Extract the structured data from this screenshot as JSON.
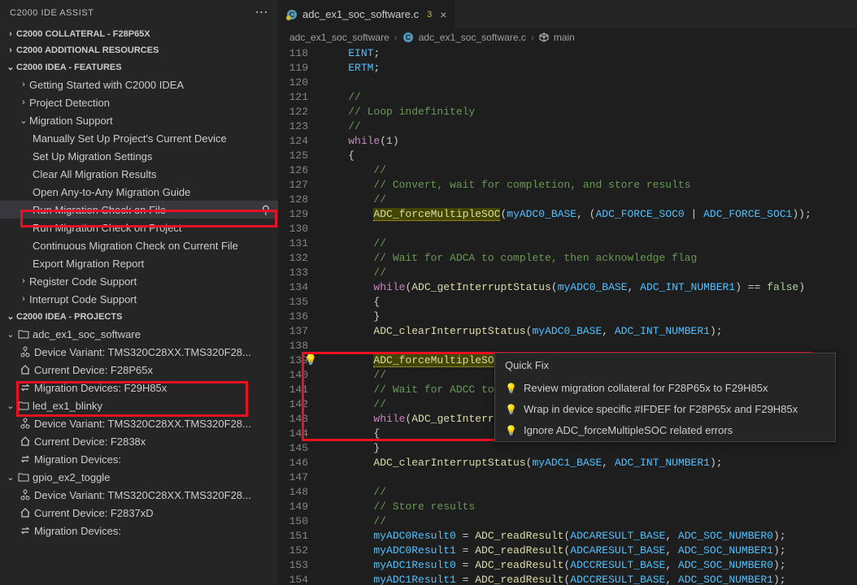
{
  "sidebar": {
    "title": "C2000 IDE ASSIST",
    "sections": [
      {
        "label": "C2000 COLLATERAL - F28P65X",
        "open": false
      },
      {
        "label": "C2000 ADDITIONAL RESOURCES",
        "open": false
      },
      {
        "label": "C2000 IDEA - FEATURES",
        "open": true,
        "items": [
          {
            "label": "Getting Started with C2000 IDEA",
            "chev": ">"
          },
          {
            "label": "Project Detection",
            "chev": ">"
          },
          {
            "label": "Migration Support",
            "chev": "v",
            "children": [
              {
                "label": "Manually Set Up Project's Current Device"
              },
              {
                "label": "Set Up Migration Settings"
              },
              {
                "label": "Clear All Migration Results"
              },
              {
                "label": "Open Any-to-Any Migration Guide"
              },
              {
                "label": "Run Migration Check on File",
                "selected": true,
                "runIcon": true
              },
              {
                "label": "Run Migration Check on Project"
              },
              {
                "label": "Continuous Migration Check on Current File"
              },
              {
                "label": "Export Migration Report"
              }
            ]
          },
          {
            "label": "Register Code Support",
            "chev": ">"
          },
          {
            "label": "Interrupt Code Support",
            "chev": ">"
          }
        ]
      },
      {
        "label": "C2000 IDEA - PROJECTS",
        "open": true,
        "projects": [
          {
            "name": "adc_ex1_soc_software",
            "open": true,
            "rows": [
              {
                "icon": "variant",
                "label": "Device Variant: TMS320C28XX.TMS320F28..."
              },
              {
                "icon": "home",
                "label": "Current Device: F28P65x"
              },
              {
                "icon": "swap",
                "label": "Migration Devices: F29H85x"
              }
            ]
          },
          {
            "name": "led_ex1_blinky",
            "open": true,
            "rows": [
              {
                "icon": "variant",
                "label": "Device Variant: TMS320C28XX.TMS320F28..."
              },
              {
                "icon": "home",
                "label": "Current Device: F2838x"
              },
              {
                "icon": "swap",
                "label": "Migration Devices:"
              }
            ]
          },
          {
            "name": "gpio_ex2_toggle",
            "open": true,
            "rows": [
              {
                "icon": "variant",
                "label": "Device Variant: TMS320C28XX.TMS320F28..."
              },
              {
                "icon": "home",
                "label": "Current Device: F2837xD"
              },
              {
                "icon": "swap",
                "label": "Migration Devices:"
              }
            ]
          }
        ]
      }
    ]
  },
  "tab": {
    "file": "adc_ex1_soc_software.c",
    "warnCount": "3"
  },
  "breadcrumb": {
    "p0": "adc_ex1_soc_software",
    "p1": "adc_ex1_soc_software.c",
    "p2": "main"
  },
  "quickfix": {
    "title": "Quick Fix",
    "items": [
      "Review migration collateral for F28P65x to F29H85x",
      "Wrap in device specific #IFDEF for F28P65x and F29H85x",
      "Ignore ADC_forceMultipleSOC related errors"
    ]
  },
  "code": {
    "startLine": 118,
    "lines": [
      {
        "t": "    EINT;"
      },
      {
        "t": "    ERTM;"
      },
      {
        "t": ""
      },
      {
        "t": "    //",
        "c": 1
      },
      {
        "t": "    // Loop indefinitely",
        "c": 1
      },
      {
        "t": "    //",
        "c": 1
      },
      {
        "t": "    while(1)",
        "kw": "while",
        "num": "1"
      },
      {
        "t": "    {"
      },
      {
        "t": "        //",
        "c": 1
      },
      {
        "t": "        // Convert, wait for completion, and store results",
        "c": 1
      },
      {
        "t": "        //",
        "c": 1
      },
      {
        "t": "        ADC_forceMultipleSOC(myADC0_BASE, (ADC_FORCE_SOC0 | ADC_FORCE_SOC1));",
        "hl": "ADC_forceMultipleSOC"
      },
      {
        "t": ""
      },
      {
        "t": "        //",
        "c": 1
      },
      {
        "t": "        // Wait for ADCA to complete, then acknowledge flag",
        "c": 1
      },
      {
        "t": "        //",
        "c": 1
      },
      {
        "t": "        while(ADC_getInterruptStatus(myADC0_BASE, ADC_INT_NUMBER1) == false)",
        "kw": "while",
        "fn": "ADC_getInterruptStatus",
        "bool": "false"
      },
      {
        "t": "        {"
      },
      {
        "t": "        }"
      },
      {
        "t": "        ADC_clearInterruptStatus(myADC0_BASE, ADC_INT_NUMBER1);",
        "fn": "ADC_clearInterruptStatus"
      },
      {
        "t": ""
      },
      {
        "t": "        ADC_forceMultipleSOC(my",
        "hl": "ADC_forceMultipleSOC",
        "bulb": true
      },
      {
        "t": "        //",
        "c": 1
      },
      {
        "t": "        // Wait for ADCC to com",
        "c": 1
      },
      {
        "t": "        //",
        "c": 1
      },
      {
        "t": "        while(ADC_getInterruptS",
        "kw": "while",
        "fn": "ADC_getInterruptS"
      },
      {
        "t": "        {"
      },
      {
        "t": "        }"
      },
      {
        "t": "        ADC_clearInterruptStatus(myADC1_BASE, ADC_INT_NUMBER1);",
        "fn": "ADC_clearInterruptStatus"
      },
      {
        "t": ""
      },
      {
        "t": "        //",
        "c": 1
      },
      {
        "t": "        // Store results",
        "c": 1
      },
      {
        "t": "        //",
        "c": 1
      },
      {
        "t": "        myADC0Result0 = ADC_readResult(ADCARESULT_BASE, ADC_SOC_NUMBER0);",
        "fn": "ADC_readResult"
      },
      {
        "t": "        myADC0Result1 = ADC_readResult(ADCARESULT_BASE, ADC_SOC_NUMBER1);",
        "fn": "ADC_readResult"
      },
      {
        "t": "        myADC1Result0 = ADC_readResult(ADCCRESULT_BASE, ADC_SOC_NUMBER0);",
        "fn": "ADC_readResult"
      },
      {
        "t": "        myADC1Result1 = ADC_readResult(ADCCRESULT_BASE, ADC_SOC_NUMBER1);",
        "fn": "ADC_readResult"
      }
    ]
  }
}
